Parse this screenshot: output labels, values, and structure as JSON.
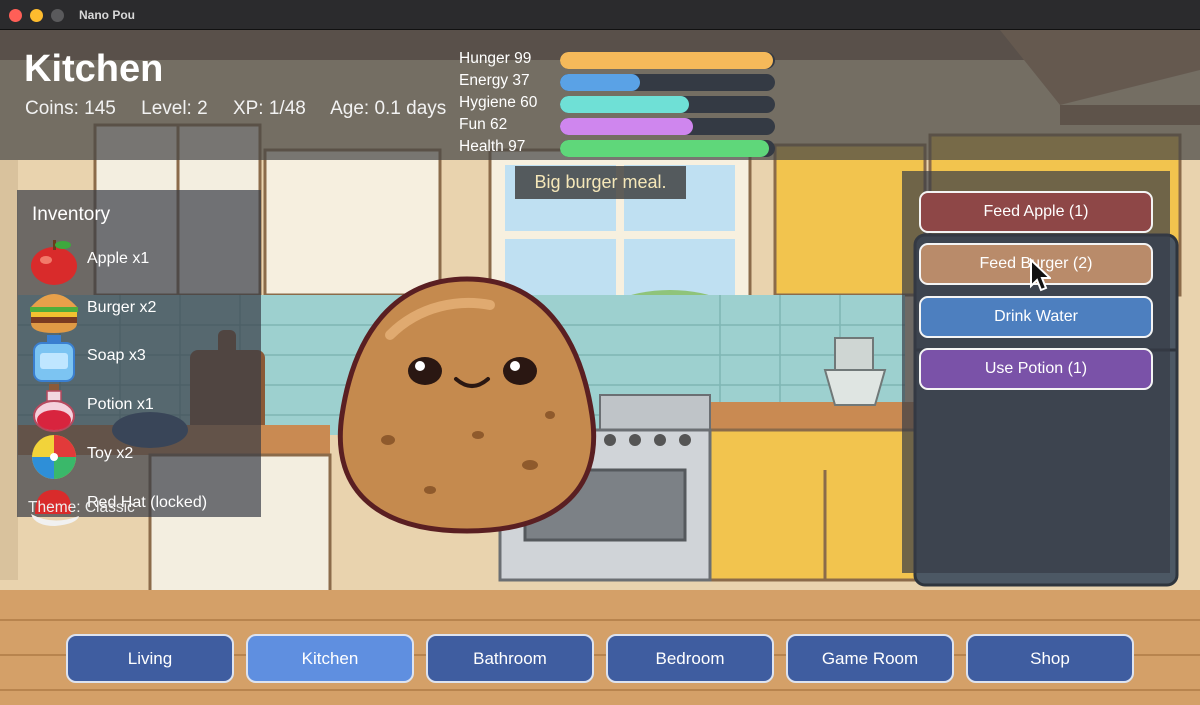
{
  "window": {
    "title": "Nano Pou"
  },
  "header": {
    "room": "Kitchen",
    "coins": "Coins: 145",
    "level": "Level: 2",
    "xp": "XP: 1/48",
    "age": "Age: 0.1 days"
  },
  "meters": [
    {
      "label": "Hunger 99",
      "value": 99,
      "color": "#f5b95a"
    },
    {
      "label": "Energy 37",
      "value": 37,
      "color": "#5aa2e6"
    },
    {
      "label": "Hygiene 60",
      "value": 60,
      "color": "#6fe0d6"
    },
    {
      "label": "Fun 62",
      "value": 62,
      "color": "#cf86ee"
    },
    {
      "label": "Health 97",
      "value": 97,
      "color": "#5fd77a"
    }
  ],
  "message": "Big burger meal.",
  "inventory": {
    "title": "Inventory",
    "items": [
      {
        "label": "Apple x1",
        "icon": "apple-icon"
      },
      {
        "label": "Burger x2",
        "icon": "burger-icon"
      },
      {
        "label": "Soap x3",
        "icon": "soap-icon"
      },
      {
        "label": "Potion x1",
        "icon": "potion-icon"
      },
      {
        "label": "Toy x2",
        "icon": "beach-ball-icon"
      },
      {
        "label": "Red Hat (locked)",
        "icon": "red-hat-icon"
      }
    ],
    "theme": "Theme: Classic"
  },
  "actions": [
    {
      "label": "Feed Apple (1)",
      "color": "#8e4747"
    },
    {
      "label": "Feed Burger (2)",
      "color": "#b98b6a"
    },
    {
      "label": "Drink Water",
      "color": "#4d7fbf"
    },
    {
      "label": "Use Potion (1)",
      "color": "#7a52a8"
    }
  ],
  "nav": [
    {
      "label": "Living",
      "active": false
    },
    {
      "label": "Kitchen",
      "active": true
    },
    {
      "label": "Bathroom",
      "active": false
    },
    {
      "label": "Bedroom",
      "active": false
    },
    {
      "label": "Game Room",
      "active": false
    },
    {
      "label": "Shop",
      "active": false
    }
  ],
  "colors": {
    "nav_inactive": "#3f5da0",
    "nav_active": "#5f8fe0"
  }
}
